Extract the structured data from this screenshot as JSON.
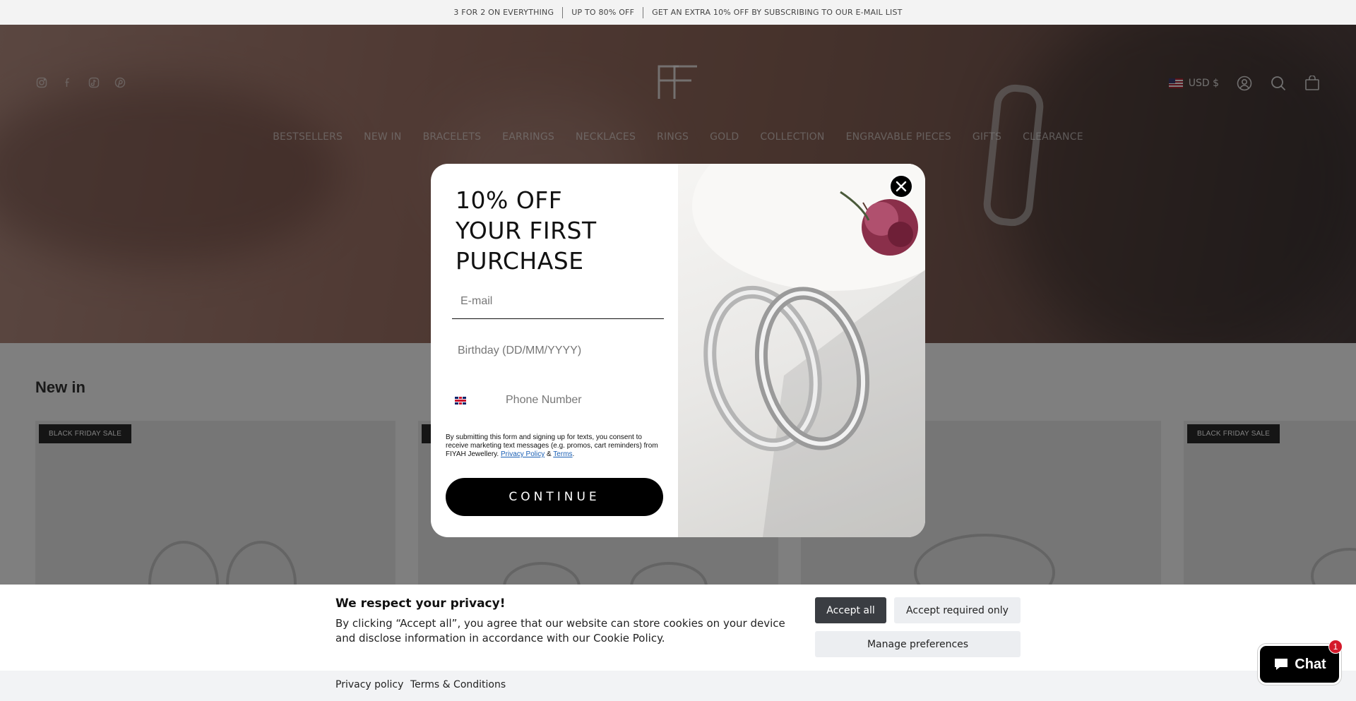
{
  "announcement": {
    "messages": [
      "3 FOR 2 ON EVERYTHING",
      "UP TO 80% OFF",
      "GET AN EXTRA 10% OFF BY SUBSCRIBING TO OUR E-MAIL LIST"
    ]
  },
  "header": {
    "social_icons": [
      "instagram-icon",
      "facebook-icon",
      "tiktok-icon",
      "pinterest-icon"
    ],
    "currency": "USD $",
    "util_icons": [
      "account-icon",
      "search-icon",
      "cart-icon"
    ]
  },
  "nav": {
    "items": [
      "BESTSELLERS",
      "NEW IN",
      "BRACELETS",
      "EARRINGS",
      "NECKLACES",
      "RINGS",
      "GOLD",
      "COLLECTION",
      "ENGRAVABLE PIECES",
      "GIFTS",
      "CLEARANCE"
    ]
  },
  "section": {
    "title": "New in",
    "badge": "BLACK FRIDAY SALE"
  },
  "popup": {
    "headline_lines": [
      "10% OFF",
      "YOUR FIRST",
      "PURCHASE"
    ],
    "email_placeholder": "E-mail",
    "birthday_placeholder": "Birthday (DD/MM/YYYY)",
    "phone_placeholder": "Phone Number",
    "consent_text": "By submitting this form and signing up for texts, you consent to receive marketing text messages (e.g. promos, cart reminders) from FIYAH Jewellery.",
    "privacy_link": "Privacy Policy",
    "amp": "&",
    "terms_link": "Terms",
    "period": ".",
    "continue_label": "CONTINUE"
  },
  "cookie": {
    "title": "We respect your privacy!",
    "body": "By clicking “Accept all”, you agree that our website can store cookies on your device and disclose information in accordance with our Cookie Policy.",
    "accept_all": "Accept all",
    "accept_required": "Accept required only",
    "manage": "Manage preferences",
    "privacy_policy": "Privacy policy",
    "terms": "Terms & Conditions"
  },
  "chat": {
    "label": "Chat",
    "badge_count": "1"
  }
}
